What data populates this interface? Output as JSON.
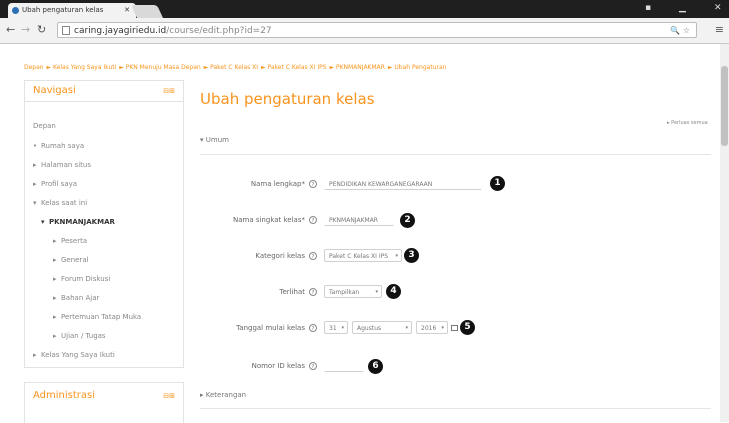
{
  "browser": {
    "tab_title": "Ubah pengaturan kelas",
    "url_domain": "caring.jayagiriedu.id",
    "url_path": "/course/edit.php?id=27"
  },
  "breadcrumb": [
    "Depan",
    "Kelas Yang Saya Ikuti",
    "PKN Menuju Masa Depan",
    "Paket C Kelas XI",
    "Paket C Kelas XI IPS",
    "PKNMANJAKMAR",
    "Ubah Pengaturan"
  ],
  "navigation": {
    "title": "Navigasi",
    "items": [
      {
        "label": "Depan"
      },
      {
        "label": "Rumah saya"
      },
      {
        "label": "Halaman situs"
      },
      {
        "label": "Profil saya"
      },
      {
        "label": "Kelas saat ini"
      },
      {
        "label": "PKNMANJAKMAR"
      },
      {
        "label": "Peserta"
      },
      {
        "label": "General"
      },
      {
        "label": "Forum Diskusi"
      },
      {
        "label": "Bahan Ajar"
      },
      {
        "label": "Pertemuan Tatap Muka"
      },
      {
        "label": "Ujian / Tugas"
      },
      {
        "label": "Kelas Yang Saya Ikuti"
      }
    ]
  },
  "admin": {
    "title": "Administrasi"
  },
  "main": {
    "title": "Ubah pengaturan kelas",
    "expand_all": "Perluas semua",
    "section_general": "Umum",
    "section_description": "Keterangan",
    "form": [
      {
        "label": "Nama lengkap*",
        "value": "PENDIDIKAN KEWARGANEGARAAN",
        "badge": "1"
      },
      {
        "label": "Nama singkat kelas*",
        "value": "PKNMANJAKMAR",
        "badge": "2"
      },
      {
        "label": "Kategori kelas",
        "value": "Paket C Kelas XI IPS",
        "badge": "3"
      },
      {
        "label": "Terlihat",
        "value": "Tampilkan",
        "badge": "4"
      },
      {
        "label": "Tanggal mulai kelas",
        "day": "31",
        "month": "Agustus",
        "year": "2016",
        "badge": "5"
      },
      {
        "label": "Nomor ID kelas",
        "value": "",
        "badge": "6"
      }
    ]
  },
  "colors": {
    "accent": "#f7941d"
  }
}
